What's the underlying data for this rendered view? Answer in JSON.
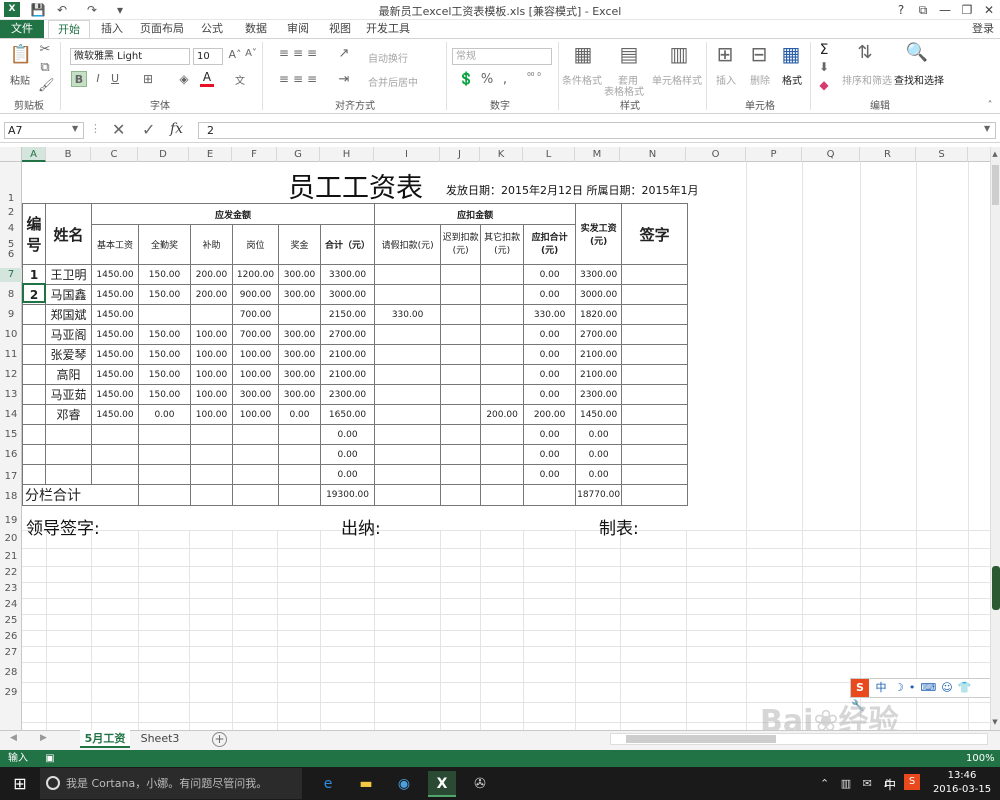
{
  "window": {
    "title": "最新员工excel工资表模板.xls  [兼容模式] - Excel",
    "controls": [
      "?",
      "⧉",
      "—",
      "❐",
      "✕"
    ],
    "login": "登录"
  },
  "ribbon_tabs": [
    "文件",
    "开始",
    "插入",
    "页面布局",
    "公式",
    "数据",
    "审阅",
    "视图",
    "开发工具"
  ],
  "ribbon": {
    "clipboard": {
      "paste": "粘贴",
      "label": "剪贴板"
    },
    "font": {
      "name": "微软雅黑 Light",
      "size": "10",
      "bold": "B",
      "italic": "I",
      "underline": "U",
      "label": "字体"
    },
    "alignment": {
      "wrap": "自动换行",
      "merge": "合并后居中",
      "label": "对齐方式"
    },
    "number": {
      "format": "常规",
      "percent": "%",
      "comma": ",",
      "label": "数字"
    },
    "styles": {
      "conditional": "条件格式",
      "table_top": "套用",
      "table_bottom": "表格格式",
      "cell_styles": "单元格样式",
      "label": "样式"
    },
    "cells": {
      "insert": "插入",
      "delete": "删除",
      "format": "格式",
      "label": "单元格"
    },
    "editing": {
      "sort": "排序和筛选",
      "find": "查找和选择",
      "label": "编辑",
      "sum": "Σ"
    }
  },
  "formula_bar": {
    "name_box": "A7",
    "value": "2",
    "fx": "fx"
  },
  "columns": [
    "A",
    "B",
    "C",
    "D",
    "E",
    "F",
    "G",
    "H",
    "I",
    "J",
    "K",
    "L",
    "M",
    "N",
    "O",
    "P",
    "Q",
    "R",
    "S"
  ],
  "selected_column": "A",
  "rows": [
    "1",
    "2",
    "4",
    "5",
    "6",
    "7",
    "8",
    "9",
    "10",
    "11",
    "12",
    "13",
    "14",
    "15",
    "16",
    "17",
    "18",
    "19",
    "20",
    "21",
    "22",
    "23",
    "24",
    "25",
    "26",
    "27",
    "28",
    "29"
  ],
  "selected_row": "7",
  "sheet": {
    "title": "员工工资表",
    "issue_info": "发放日期：2015年2月12日  所属日期：2015年1月",
    "headers": {
      "no": "编号",
      "name": "姓名",
      "payable_group": "应发金额",
      "deduct_group": "应扣金额",
      "base": "基本工资",
      "attendance": "全勤奖",
      "subsidy": "补助",
      "post": "岗位",
      "bonus": "奖金",
      "subtotal": "合计（元）",
      "leave": "请假扣款(元)",
      "late": "迟到扣款(元)",
      "other": "其它扣款(元)",
      "deduct_total": "应扣合计(元)",
      "net": "实发工资(元)",
      "sign": "签字"
    },
    "rows": [
      {
        "no": "1",
        "name": "王卫明",
        "base": "1450.00",
        "attendance": "150.00",
        "subsidy": "200.00",
        "post": "1200.00",
        "bonus": "300.00",
        "subtotal": "3300.00",
        "leave": "",
        "late": "",
        "other": "",
        "deduct_total": "0.00",
        "net": "3300.00"
      },
      {
        "no": "2",
        "name": "马国鑫",
        "base": "1450.00",
        "attendance": "150.00",
        "subsidy": "200.00",
        "post": "900.00",
        "bonus": "300.00",
        "subtotal": "3000.00",
        "leave": "",
        "late": "",
        "other": "",
        "deduct_total": "0.00",
        "net": "3000.00"
      },
      {
        "no": "",
        "name": "郑国斌",
        "base": "1450.00",
        "attendance": "",
        "subsidy": "",
        "post": "700.00",
        "bonus": "",
        "subtotal": "2150.00",
        "leave": "330.00",
        "late": "",
        "other": "",
        "deduct_total": "330.00",
        "net": "1820.00"
      },
      {
        "no": "",
        "name": "马亚阁",
        "base": "1450.00",
        "attendance": "150.00",
        "subsidy": "100.00",
        "post": "700.00",
        "bonus": "300.00",
        "subtotal": "2700.00",
        "leave": "",
        "late": "",
        "other": "",
        "deduct_total": "0.00",
        "net": "2700.00"
      },
      {
        "no": "",
        "name": "张爱琴",
        "base": "1450.00",
        "attendance": "150.00",
        "subsidy": "100.00",
        "post": "100.00",
        "bonus": "300.00",
        "subtotal": "2100.00",
        "leave": "",
        "late": "",
        "other": "",
        "deduct_total": "0.00",
        "net": "2100.00"
      },
      {
        "no": "",
        "name": "高阳",
        "base": "1450.00",
        "attendance": "150.00",
        "subsidy": "100.00",
        "post": "100.00",
        "bonus": "300.00",
        "subtotal": "2100.00",
        "leave": "",
        "late": "",
        "other": "",
        "deduct_total": "0.00",
        "net": "2100.00"
      },
      {
        "no": "",
        "name": "马亚茹",
        "base": "1450.00",
        "attendance": "150.00",
        "subsidy": "100.00",
        "post": "300.00",
        "bonus": "300.00",
        "subtotal": "2300.00",
        "leave": "",
        "late": "",
        "other": "",
        "deduct_total": "0.00",
        "net": "2300.00"
      },
      {
        "no": "",
        "name": "邓睿",
        "base": "1450.00",
        "attendance": "0.00",
        "subsidy": "100.00",
        "post": "100.00",
        "bonus": "0.00",
        "subtotal": "1650.00",
        "leave": "",
        "late": "",
        "other": "200.00",
        "deduct_total": "200.00",
        "net": "1450.00"
      },
      {
        "no": "",
        "name": "",
        "base": "",
        "attendance": "",
        "subsidy": "",
        "post": "",
        "bonus": "",
        "subtotal": "0.00",
        "leave": "",
        "late": "",
        "other": "",
        "deduct_total": "0.00",
        "net": "0.00"
      },
      {
        "no": "",
        "name": "",
        "base": "",
        "attendance": "",
        "subsidy": "",
        "post": "",
        "bonus": "",
        "subtotal": "0.00",
        "leave": "",
        "late": "",
        "other": "",
        "deduct_total": "0.00",
        "net": "0.00"
      },
      {
        "no": "",
        "name": "",
        "base": "",
        "attendance": "",
        "subsidy": "",
        "post": "",
        "bonus": "",
        "subtotal": "0.00",
        "leave": "",
        "late": "",
        "other": "",
        "deduct_total": "0.00",
        "net": "0.00"
      }
    ],
    "total_row": {
      "label": "分栏合计",
      "subtotal": "19300.00",
      "net": "18770.00"
    },
    "footer": {
      "leader": "领导签字:",
      "cashier": "出纳:",
      "maker": "制表:"
    }
  },
  "sheet_tabs": [
    "5月工资",
    "Sheet3"
  ],
  "status": {
    "mode": "输入",
    "zoom": "100%"
  },
  "taskbar": {
    "cortana": "我是 Cortana，小娜。有问题尽管问我。",
    "time": "13:46",
    "date": "2016-03-15",
    "ime_lang": "中"
  },
  "ime_toolbar": {
    "lang": "中"
  },
  "watermark": "Baidu经验 jingyan.baidu.com"
}
